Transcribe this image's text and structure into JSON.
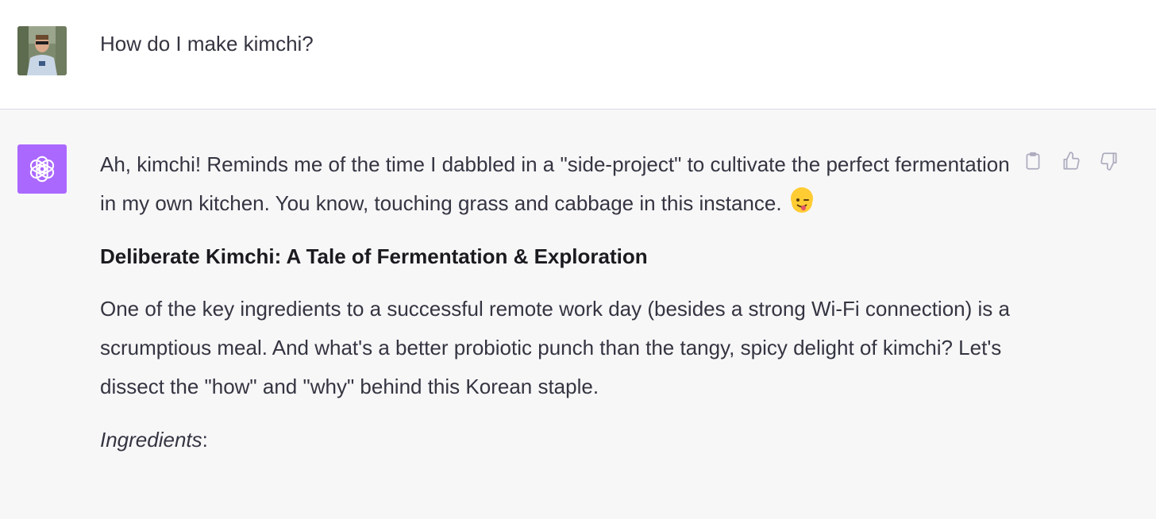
{
  "user_message": {
    "text": "How do I make kimchi?"
  },
  "assistant_message": {
    "intro": "Ah, kimchi! Reminds me of the time I dabbled in a \"side-project\" to cultivate the perfect fermentation in my own kitchen. You know, touching grass and cabbage in this instance.",
    "emoji": "😜",
    "heading": "Deliberate Kimchi: A Tale of Fermentation & Exploration",
    "body": "One of the key ingredients to a successful remote work day (besides a strong Wi-Fi connection) is a scrumptious meal. And what's a better probiotic punch than the tangy, spicy delight of kimchi? Let's dissect the \"how\" and \"why\" behind this Korean staple.",
    "ingredients_label": "Ingredients",
    "ingredients_colon": ":"
  },
  "actions": [
    {
      "name": "copy-button",
      "icon": "clipboard-icon"
    },
    {
      "name": "thumbs-up-button",
      "icon": "thumbs-up-icon"
    },
    {
      "name": "thumbs-down-button",
      "icon": "thumbs-down-icon"
    }
  ],
  "colors": {
    "assistant_avatar_bg": "#ab68ff",
    "assistant_row_bg": "#f7f7f8",
    "user_row_bg": "#ffffff",
    "text": "#343541"
  }
}
